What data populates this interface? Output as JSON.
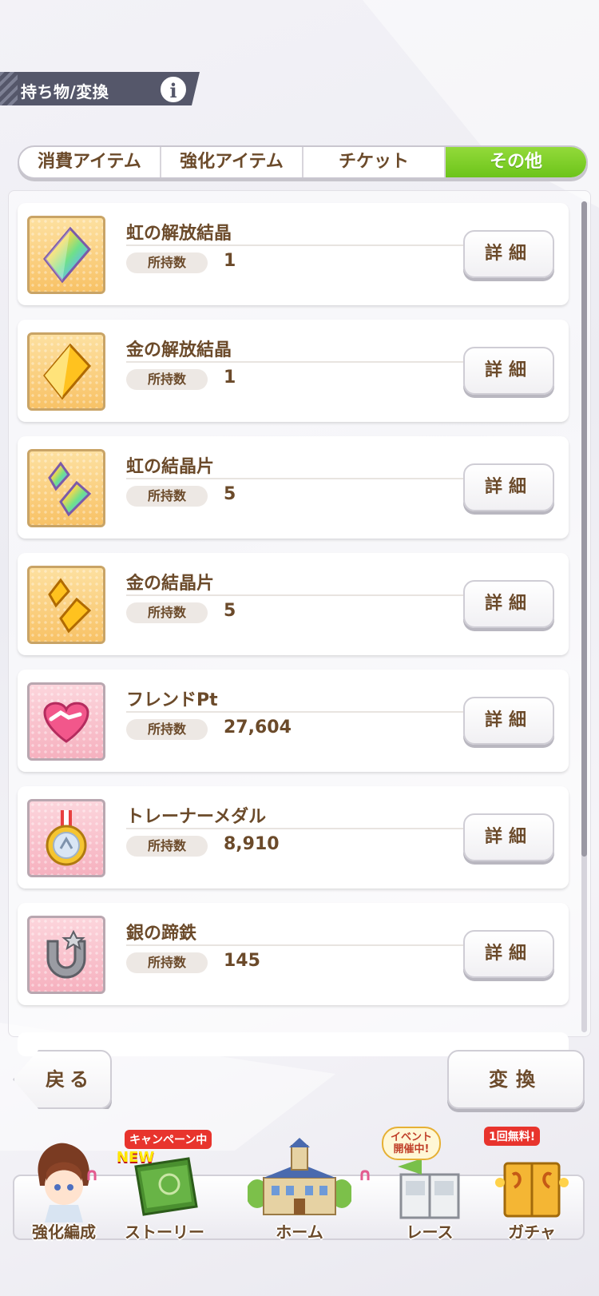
{
  "header": {
    "title": "持ち物/変換",
    "info_label": "i"
  },
  "tabs": [
    {
      "label": "消費アイテム",
      "active": false
    },
    {
      "label": "強化アイテム",
      "active": false
    },
    {
      "label": "チケット",
      "active": false
    },
    {
      "label": "その他",
      "active": true
    }
  ],
  "items": [
    {
      "name": "虹の解放結晶",
      "own_label": "所持数",
      "count": "1",
      "detail_label": "詳細",
      "icon": "rainbow-crystal-icon"
    },
    {
      "name": "金の解放結晶",
      "own_label": "所持数",
      "count": "1",
      "detail_label": "詳細",
      "icon": "gold-crystal-icon"
    },
    {
      "name": "虹の結晶片",
      "own_label": "所持数",
      "count": "5",
      "detail_label": "詳細",
      "icon": "rainbow-shard-icon"
    },
    {
      "name": "金の結晶片",
      "own_label": "所持数",
      "count": "5",
      "detail_label": "詳細",
      "icon": "gold-shard-icon"
    },
    {
      "name": "フレンドPt",
      "own_label": "所持数",
      "count": "27,604",
      "detail_label": "詳細",
      "icon": "handshake-icon"
    },
    {
      "name": "トレーナーメダル",
      "own_label": "所持数",
      "count": "8,910",
      "detail_label": "詳細",
      "icon": "medal-icon"
    },
    {
      "name": "銀の蹄鉄",
      "own_label": "所持数",
      "count": "145",
      "detail_label": "詳細",
      "icon": "silver-horseshoe-icon"
    }
  ],
  "actions": {
    "back_label": "戻る",
    "convert_label": "変換"
  },
  "nav": [
    {
      "label": "強化編成",
      "icon": "character-icon"
    },
    {
      "label": "ストーリー",
      "icon": "story-book-icon",
      "badge": "キャンペーン中",
      "badge2": "NEW"
    },
    {
      "label": "ホーム",
      "icon": "school-building-icon"
    },
    {
      "label": "レース",
      "icon": "race-gate-icon",
      "badge": "イベント 開催中!"
    },
    {
      "label": "ガチャ",
      "icon": "gacha-door-icon",
      "badge": "1回無料!"
    }
  ],
  "colors": {
    "active_tab": "#7fcd28",
    "text_brown": "#6b4a2a",
    "header_bg": "#55576a"
  }
}
